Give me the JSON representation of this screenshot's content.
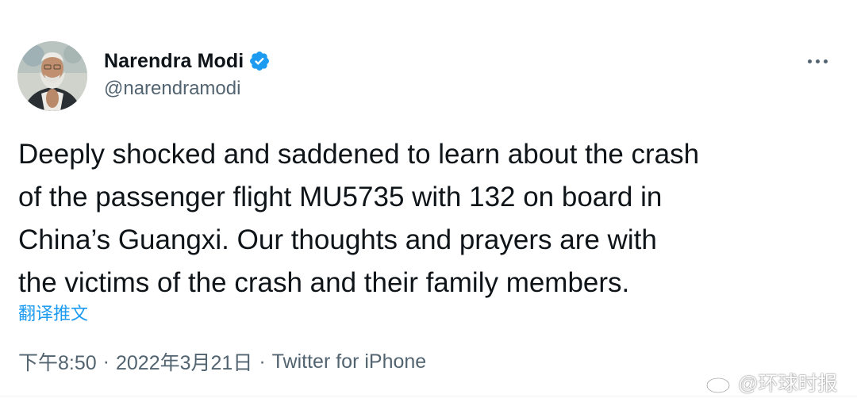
{
  "author": {
    "display_name": "Narendra Modi",
    "handle": "@narendramodi",
    "verified": true,
    "avatar_icon": "profile-photo"
  },
  "tweet": {
    "text_lines": [
      "Deeply shocked and saddened to learn about the crash",
      "of the passenger flight MU5735 with 132 on board in",
      "China’s Guangxi. Our thoughts and prayers are with",
      "the victims of the crash and their family members."
    ],
    "translate_label": "翻译推文"
  },
  "meta": {
    "time": "下午8:50",
    "separator": "·",
    "date": "2022年3月21日",
    "source": "Twitter for iPhone"
  },
  "watermark": {
    "text": "@环球时报",
    "icon": "weibo-icon"
  },
  "colors": {
    "verified_blue": "#1d9bf0",
    "link_blue": "#1d9bf0",
    "secondary_text": "#536471",
    "primary_text": "#0f1419"
  }
}
